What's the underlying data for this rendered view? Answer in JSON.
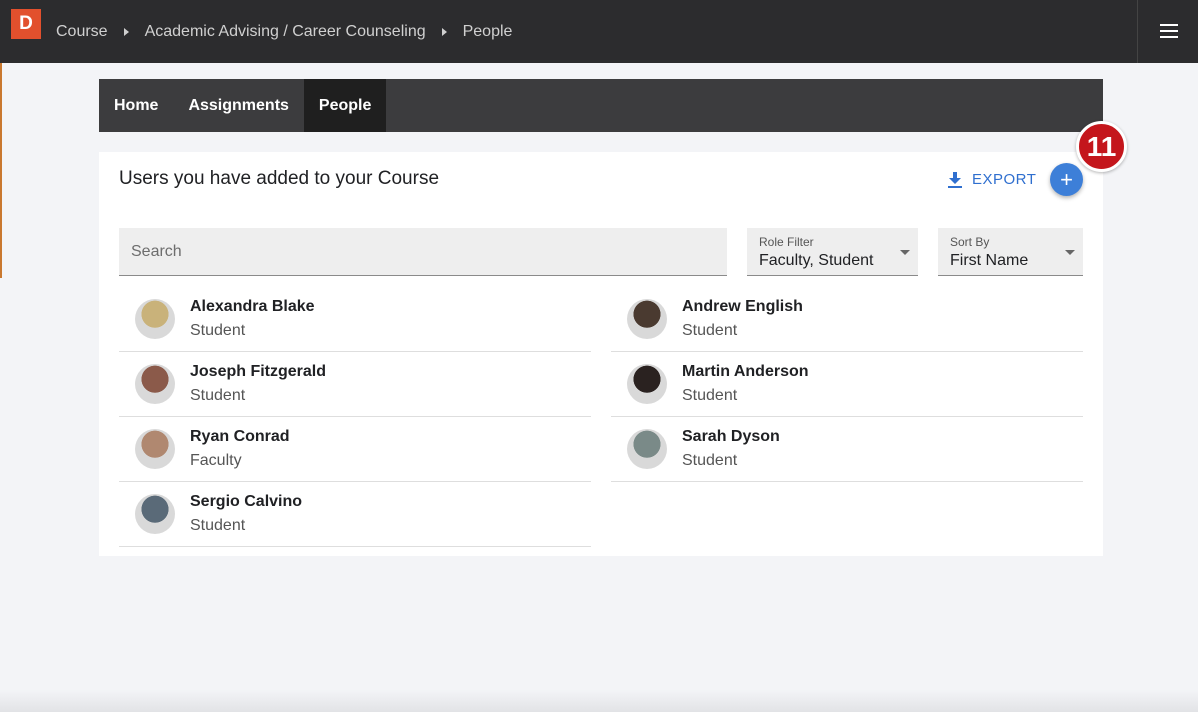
{
  "brand": {
    "logo_letter": "D",
    "logo_color": "#e2502d"
  },
  "breadcrumb": [
    "Course",
    "Academic Advising / Career Counseling",
    "People"
  ],
  "tabs": [
    {
      "label": "Home",
      "active": false
    },
    {
      "label": "Assignments",
      "active": false
    },
    {
      "label": "People",
      "active": true
    }
  ],
  "card": {
    "title": "Users you have added to your Course",
    "export_label": "EXPORT",
    "add_symbol": "+",
    "step_badge": "11"
  },
  "search": {
    "placeholder": "Search",
    "value": ""
  },
  "role_filter": {
    "label": "Role Filter",
    "value": "Faculty, Student"
  },
  "sort_by": {
    "label": "Sort By",
    "value": "First Name"
  },
  "people": [
    {
      "name": "Alexandra Blake",
      "role": "Student",
      "avatar_color": "#c9b27a"
    },
    {
      "name": "Andrew English",
      "role": "Student",
      "avatar_color": "#4a3a30"
    },
    {
      "name": "Joseph Fitzgerald",
      "role": "Student",
      "avatar_color": "#8b5a4a"
    },
    {
      "name": "Martin Anderson",
      "role": "Student",
      "avatar_color": "#2a2220"
    },
    {
      "name": "Ryan Conrad",
      "role": "Faculty",
      "avatar_color": "#b08870"
    },
    {
      "name": "Sarah Dyson",
      "role": "Student",
      "avatar_color": "#7a8a88"
    },
    {
      "name": "Sergio Calvino",
      "role": "Student",
      "avatar_color": "#5a6a78"
    }
  ],
  "colors": {
    "accent": "#3d7fd8",
    "badge": "#c4161c",
    "topbar": "#2c2c2e"
  }
}
